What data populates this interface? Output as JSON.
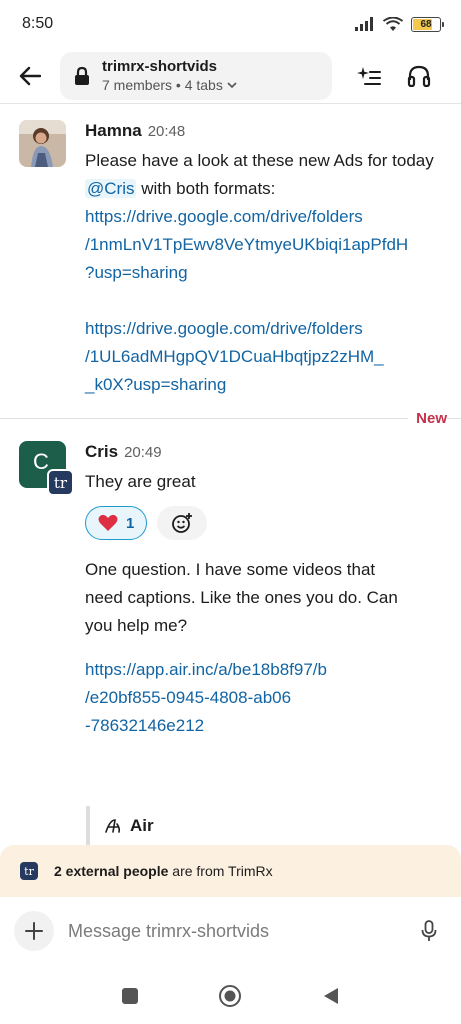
{
  "status": {
    "time": "8:50",
    "battery": "68"
  },
  "header": {
    "channel": "trimrx-shortvids",
    "meta": "7 members • 4 tabs"
  },
  "messages": [
    {
      "sender": "Hamna",
      "time": "20:48",
      "text_before": "Please have a look at these new Ads for today",
      "mention": "@Cris",
      "text_after": "with both formats:",
      "links": [
        [
          "https://drive.google.com/drive/folders",
          "/1nmLnV1TpEwv8VeYtmyeUKbiqi1apPfdH",
          "?usp=sharing"
        ],
        [
          "https://drive.google.com/drive/folders",
          "/1UL6adMHgpQV1DCuaHbqtjpz2zHM_",
          "_k0X?usp=sharing"
        ]
      ]
    },
    {
      "sender": "Cris",
      "avatar_letter": "C",
      "badge": "tr",
      "time": "20:49",
      "text": "They are great",
      "reaction": {
        "emoji": "heart",
        "count": "1"
      },
      "text2": [
        "One question. I have some videos that",
        "need captions. Like the ones you do. Can",
        "you help me?"
      ],
      "link": [
        "https://app.air.inc/a/be18b8f97/b",
        "/e20bf855-0945-4808-ab06",
        "-78632146e212"
      ],
      "quote_name": "Air"
    }
  ],
  "divider": {
    "label": "New"
  },
  "external_banner": {
    "badge": "tr",
    "bold": "2 external people",
    "rest": "are from TrimRx"
  },
  "composer": {
    "placeholder": "Message trimrx-shortvids"
  }
}
